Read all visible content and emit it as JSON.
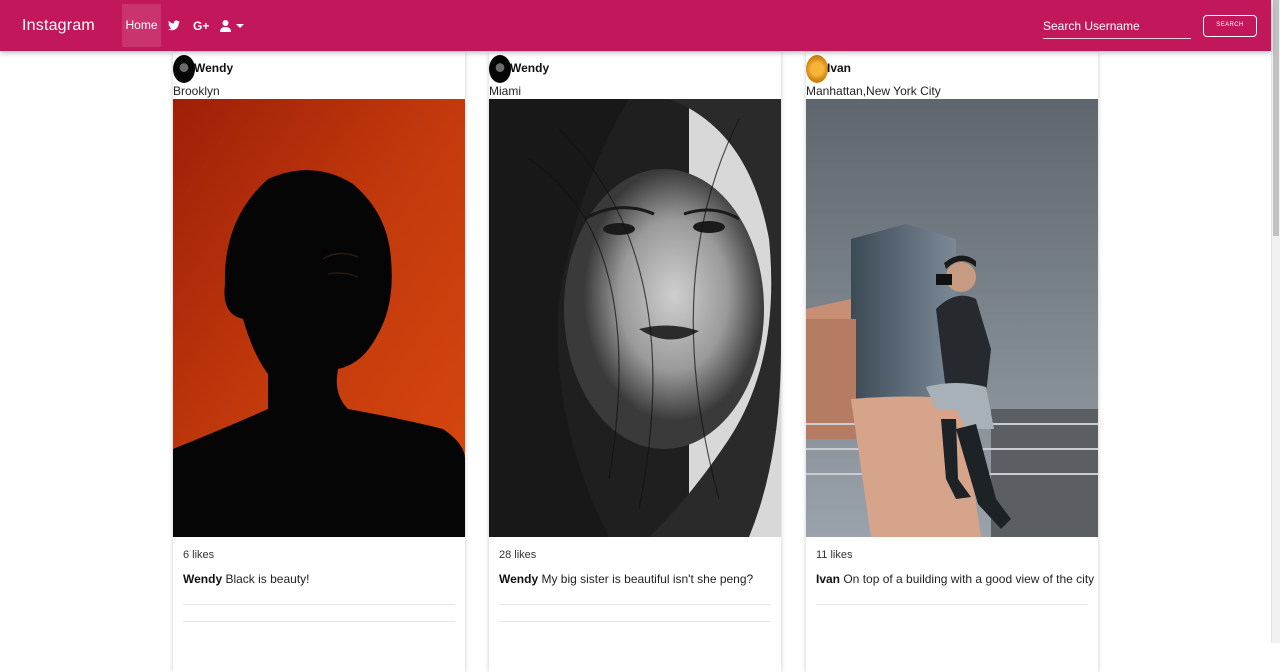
{
  "navbar": {
    "brand": "Instagram",
    "home_label": "Home",
    "search_placeholder": "Search Username",
    "search_button": "SEARCH",
    "color": "#c2185b",
    "icons": [
      "twitter-icon",
      "google-plus-icon",
      "user-icon",
      "caret-down-icon"
    ],
    "gplus_text": "G+"
  },
  "posts": [
    {
      "username": "Wendy",
      "location": "Brooklyn",
      "likes": "6 likes",
      "caption_user": "Wendy",
      "caption_text": " Black is beauty!",
      "photo": "portrait of man against orange background"
    },
    {
      "username": "Wendy",
      "location": "Miami",
      "likes": "28 likes",
      "caption_user": "Wendy",
      "caption_text": " My big sister is beautiful isn't she peng?",
      "photo": "black and white portrait of woman with windswept hair"
    },
    {
      "username": "Ivan",
      "location": "Manhattan,New York City",
      "likes": "11 likes",
      "caption_user": "Ivan",
      "caption_text": " On top of a building with a good view of the city",
      "photo": "photographer sitting on rooftop ledge with skyscrapers"
    }
  ]
}
